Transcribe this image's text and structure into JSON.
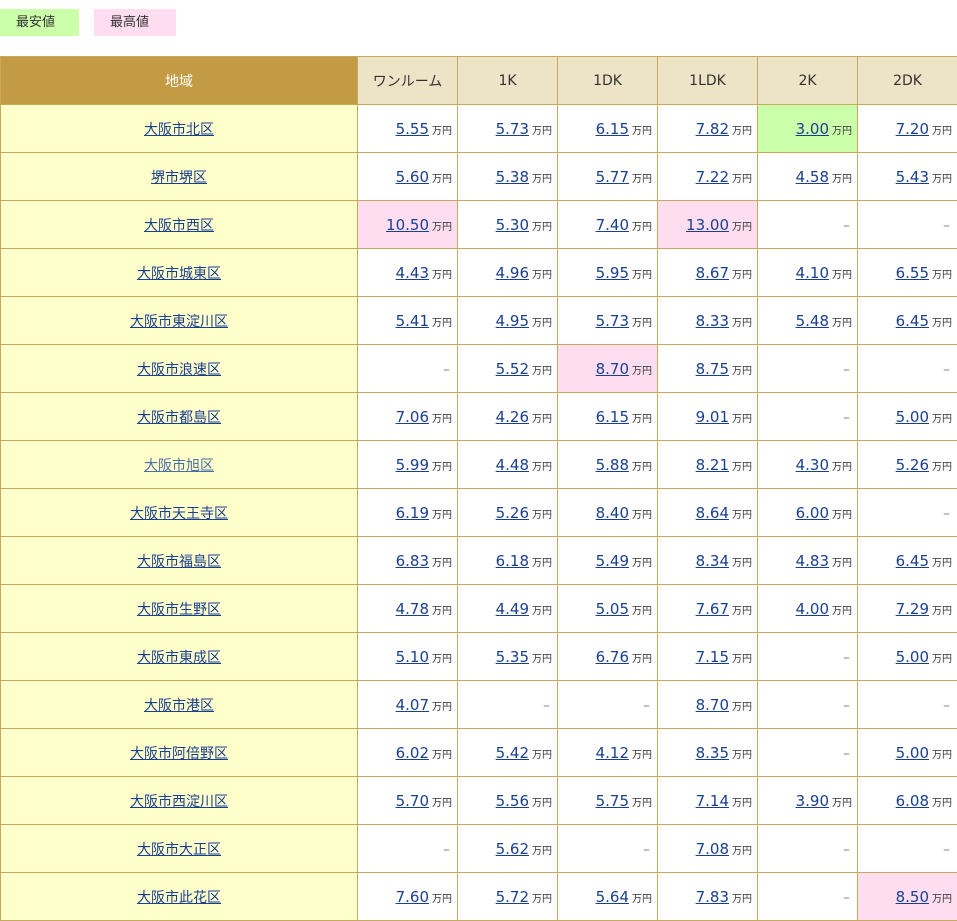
{
  "legend": {
    "low_label": "最安値",
    "high_label": "最高値"
  },
  "colors": {
    "low": "#ccffaa",
    "high": "#ffddf0",
    "area_bg": "#ffffcc",
    "header_area": "#c39b44",
    "header_col": "#ede3c6",
    "link": "#1a3f8f"
  },
  "table": {
    "area_header": "地域",
    "columns": [
      "ワンルーム",
      "1K",
      "1DK",
      "1LDK",
      "2K",
      "2DK"
    ],
    "unit": "万円",
    "dash": "–",
    "rows": [
      {
        "area": "大阪市北区",
        "values": [
          "5.55",
          "5.73",
          "6.15",
          "7.82",
          "3.00",
          "7.20"
        ],
        "low": [
          4
        ],
        "high": []
      },
      {
        "area": "堺市堺区",
        "values": [
          "5.60",
          "5.38",
          "5.77",
          "7.22",
          "4.58",
          "5.43"
        ],
        "low": [],
        "high": []
      },
      {
        "area": "大阪市西区",
        "values": [
          "10.50",
          "5.30",
          "7.40",
          "13.00",
          null,
          null
        ],
        "low": [],
        "high": [
          0,
          3
        ]
      },
      {
        "area": "大阪市城東区",
        "values": [
          "4.43",
          "4.96",
          "5.95",
          "8.67",
          "4.10",
          "6.55"
        ],
        "low": [],
        "high": []
      },
      {
        "area": "大阪市東淀川区",
        "values": [
          "5.41",
          "4.95",
          "5.73",
          "8.33",
          "5.48",
          "6.45"
        ],
        "low": [],
        "high": []
      },
      {
        "area": "大阪市浪速区",
        "values": [
          null,
          "5.52",
          "8.70",
          "8.75",
          null,
          null
        ],
        "low": [],
        "high": [
          2
        ]
      },
      {
        "area": "大阪市都島区",
        "values": [
          "7.06",
          "4.26",
          "6.15",
          "9.01",
          null,
          "5.00"
        ],
        "low": [],
        "high": []
      },
      {
        "area": "大阪市旭区",
        "values": [
          "5.99",
          "4.48",
          "5.88",
          "8.21",
          "4.30",
          "5.26"
        ],
        "low": [],
        "high": [],
        "visited": true
      },
      {
        "area": "大阪市天王寺区",
        "values": [
          "6.19",
          "5.26",
          "8.40",
          "8.64",
          "6.00",
          null
        ],
        "low": [],
        "high": []
      },
      {
        "area": "大阪市福島区",
        "values": [
          "6.83",
          "6.18",
          "5.49",
          "8.34",
          "4.83",
          "6.45"
        ],
        "low": [],
        "high": []
      },
      {
        "area": "大阪市生野区",
        "values": [
          "4.78",
          "4.49",
          "5.05",
          "7.67",
          "4.00",
          "7.29"
        ],
        "low": [],
        "high": []
      },
      {
        "area": "大阪市東成区",
        "values": [
          "5.10",
          "5.35",
          "6.76",
          "7.15",
          null,
          "5.00"
        ],
        "low": [],
        "high": []
      },
      {
        "area": "大阪市港区",
        "values": [
          "4.07",
          null,
          null,
          "8.70",
          null,
          null
        ],
        "low": [],
        "high": []
      },
      {
        "area": "大阪市阿倍野区",
        "values": [
          "6.02",
          "5.42",
          "4.12",
          "8.35",
          null,
          "5.00"
        ],
        "low": [],
        "high": []
      },
      {
        "area": "大阪市西淀川区",
        "values": [
          "5.70",
          "5.56",
          "5.75",
          "7.14",
          "3.90",
          "6.08"
        ],
        "low": [],
        "high": []
      },
      {
        "area": "大阪市大正区",
        "values": [
          null,
          "5.62",
          null,
          "7.08",
          null,
          null
        ],
        "low": [],
        "high": []
      },
      {
        "area": "大阪市此花区",
        "values": [
          "7.60",
          "5.72",
          "5.64",
          "7.83",
          null,
          "8.50"
        ],
        "low": [],
        "high": [
          5
        ]
      }
    ]
  }
}
